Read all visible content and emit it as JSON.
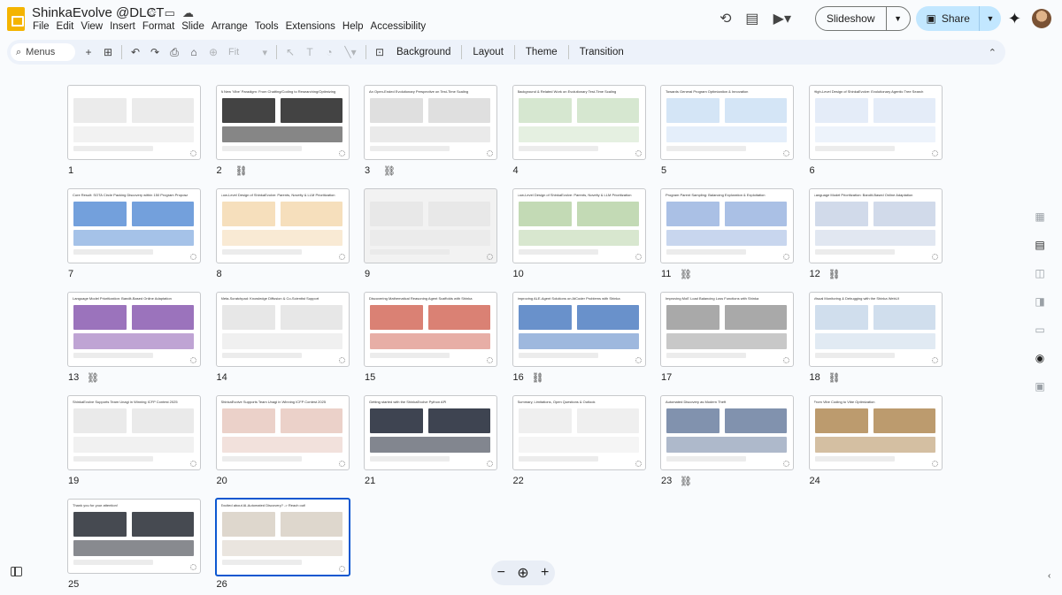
{
  "document": {
    "title": "ShinkaEvolve @DLCT"
  },
  "menu": [
    "File",
    "Edit",
    "View",
    "Insert",
    "Format",
    "Slide",
    "Arrange",
    "Tools",
    "Extensions",
    "Help",
    "Accessibility"
  ],
  "header": {
    "slideshow_label": "Slideshow",
    "share_label": "Share"
  },
  "toolbar": {
    "search_placeholder": "Menus",
    "zoom_value": "Fit",
    "background_label": "Background",
    "layout_label": "Layout",
    "theme_label": "Theme",
    "transition_label": "Transition"
  },
  "slides": [
    {
      "number": "1",
      "title": "",
      "link": false,
      "bg": "#fff",
      "accent": "#e8e8e8"
    },
    {
      "number": "2",
      "title": "A New 'Vibe' Paradigm: From Chatting/Coding to Researching/Optimizing",
      "link": true,
      "bg": "#fff",
      "accent": "#222"
    },
    {
      "number": "3",
      "title": "An Open-Ended Evolutionary Perspective on Test-Time Scaling",
      "link": true,
      "bg": "#fff",
      "accent": "#d9d9d9"
    },
    {
      "number": "4",
      "title": "Background & Related Work on Evolutionary Test-Time Scaling",
      "link": false,
      "bg": "#fff",
      "accent": "#cfe3c8"
    },
    {
      "number": "5",
      "title": "Towards General Program Optimization & Innovation",
      "link": false,
      "bg": "#fff",
      "accent": "#cde0f5"
    },
    {
      "number": "6",
      "title": "High-Level Design of ShinkaEvolve: Evolutionary Agentic Tree Search",
      "link": false,
      "bg": "#fff",
      "accent": "#dfe9f7"
    },
    {
      "number": "7",
      "title": "Core Result: SOTA Circle Packing Discovery within 150 Program Proposals",
      "link": false,
      "bg": "#fff",
      "accent": "#5b8fd6"
    },
    {
      "number": "8",
      "title": "Low-Level Design of ShinkaEvolve: Parents, Novelty & LLM Prioritization",
      "link": false,
      "bg": "#fff",
      "accent": "#f4d9b0"
    },
    {
      "number": "9",
      "title": "",
      "link": false,
      "bg": "#f2f2f2",
      "accent": "#e6e6e6"
    },
    {
      "number": "10",
      "title": "Low-Level Design of ShinkaEvolve: Parents, Novelty & LLM Prioritization",
      "link": false,
      "bg": "#fff",
      "accent": "#b8d4a8"
    },
    {
      "number": "11",
      "title": "Program Parent Sampling: Balancing Exploration & Exploitation",
      "link": true,
      "bg": "#fff",
      "accent": "#9bb5e0"
    },
    {
      "number": "12",
      "title": "Language Model Prioritization: Bandit-Based Online Adaptation",
      "link": true,
      "bg": "#fff",
      "accent": "#c9d4e6"
    },
    {
      "number": "13",
      "title": "Language Model Prioritization: Bandit-Based Online Adaptation",
      "link": true,
      "bg": "#fff",
      "accent": "#8a5ab0"
    },
    {
      "number": "14",
      "title": "Meta-Scratchpad: Knowledge Diffusion & Co-Scientist Support",
      "link": false,
      "bg": "#fff",
      "accent": "#e3e3e3"
    },
    {
      "number": "15",
      "title": "Discovering Mathematical Reasoning Agent Scaffolds with Shinka",
      "link": false,
      "bg": "#fff",
      "accent": "#d46b5c"
    },
    {
      "number": "16",
      "title": "Improving ALE-Agent Solutions on AtCoder Problems with Shinka",
      "link": true,
      "bg": "#fff",
      "accent": "#4f7ec2"
    },
    {
      "number": "17",
      "title": "Improving MoE Load Balancing Loss Functions with Shinka",
      "link": false,
      "bg": "#fff",
      "accent": "#9a9a9a"
    },
    {
      "number": "18",
      "title": "Visual Monitoring & Debugging with the Shinka WebUI",
      "link": true,
      "bg": "#fff",
      "accent": "#c8d8ea"
    },
    {
      "number": "19",
      "title": "ShinkaEvolve Supports Team Unagi in Winning ICFP Contest 2025",
      "link": false,
      "bg": "#fff",
      "accent": "#e6e6e6"
    },
    {
      "number": "20",
      "title": "ShinkaEvolve Supports Team Unagi in Winning ICFP Contest 2025",
      "link": false,
      "bg": "#fff",
      "accent": "#e8c9c0"
    },
    {
      "number": "21",
      "title": "Getting started with the ShinkaEvolve Python API",
      "link": false,
      "bg": "#fff",
      "accent": "#1c2333"
    },
    {
      "number": "22",
      "title": "Summary, Limitations, Open Questions & Outlook",
      "link": false,
      "bg": "#fff",
      "accent": "#ececec"
    },
    {
      "number": "23",
      "title": "Automated Discovery as Modern Theft",
      "link": true,
      "bg": "#fff",
      "accent": "#6b7fa0"
    },
    {
      "number": "24",
      "title": "From Vibe Coding to Vibe Optimization",
      "link": false,
      "bg": "#fff",
      "accent": "#b08a55"
    },
    {
      "number": "25",
      "title": "Thank you for your attention!",
      "link": false,
      "bg": "#fff",
      "accent": "#262a33"
    },
    {
      "number": "26",
      "title": "Excited about AI-Automated Discovery? -> Reach out!",
      "link": false,
      "bg": "#fff",
      "accent": "#d8d0c4",
      "selected": true
    }
  ]
}
